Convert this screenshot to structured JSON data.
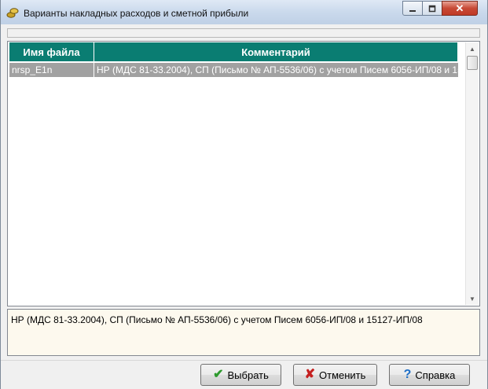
{
  "window": {
    "title": "Варианты накладных расходов и сметной прибыли",
    "icon": "coins-icon"
  },
  "table": {
    "columns": [
      "Имя файла",
      "Комментарий"
    ],
    "rows": [
      {
        "file": "nrsp_E1n",
        "comment": "НР (МДС 81-33.2004), СП (Письмо № АП-5536/06) с учетом Писем 6056-ИП/08 и 15127-ИП/08",
        "selected": true
      }
    ]
  },
  "memo": {
    "text": "НР (МДС 81-33.2004), СП (Письмо № АП-5536/06) с учетом Писем 6056-ИП/08 и 15127-ИП/08"
  },
  "buttons": {
    "select": "Выбрать",
    "cancel": "Отменить",
    "help": "Справка"
  },
  "colors": {
    "header_bg": "#0a7d72",
    "selected_row_bg": "#a1a1a1",
    "memo_bg": "#fdf9ee"
  }
}
